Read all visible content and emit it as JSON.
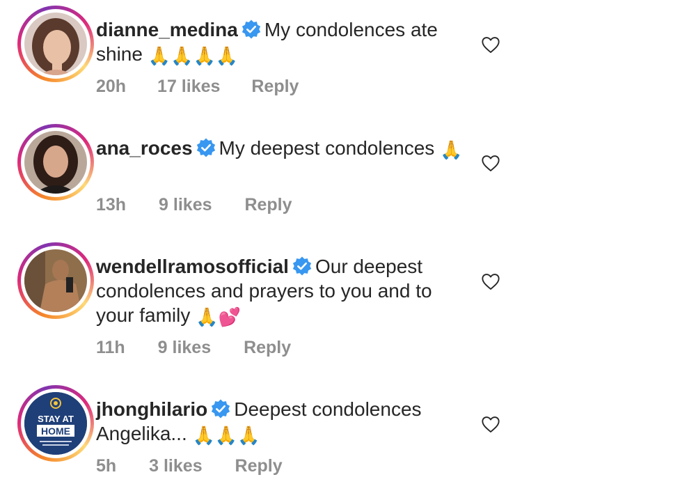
{
  "comments": [
    {
      "username": "dianne_medina",
      "text": "My condolences ate shine",
      "emoji": "🙏🙏🙏🙏",
      "time": "20h",
      "likes": "17 likes",
      "reply": "Reply"
    },
    {
      "username": "ana_roces",
      "text": "My deepest condolences",
      "emoji": "🙏",
      "time": "13h",
      "likes": "9 likes",
      "reply": "Reply"
    },
    {
      "username": "wendellramosofficial",
      "text": "Our deepest condolences and prayers to you and to your family",
      "emoji": "🙏💕",
      "time": "11h",
      "likes": "9 likes",
      "reply": "Reply"
    },
    {
      "username": "jhonghilario",
      "text": "Deepest condolences Angelika...",
      "emoji": "🙏🙏🙏",
      "time": "5h",
      "likes": "3 likes",
      "reply": "Reply"
    }
  ],
  "avatar4_badge": {
    "line1": "STAY AT",
    "line2": "HOME"
  },
  "colors": {
    "verified": "#3897f0",
    "meta_text": "#8e8e8e",
    "text": "#262626",
    "ring_start": "#f58529",
    "ring_end": "#dd2a7b"
  },
  "icons": {
    "verified": "verified-badge-icon",
    "like": "heart-outline-icon"
  }
}
